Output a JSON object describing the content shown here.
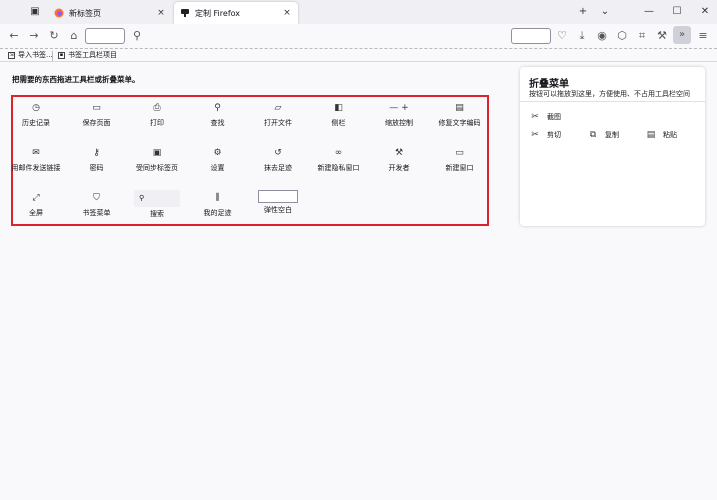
{
  "tabs": [
    {
      "title": "新标签页",
      "close": "×",
      "icon": "firefox-logo-icon"
    },
    {
      "title": "定制 Firefox",
      "close": "×",
      "icon": "customize-icon"
    }
  ],
  "window_controls": {
    "new_tab": "+",
    "tab_list": "⌄",
    "minimize": "—",
    "maximize": "☐",
    "close": "✕"
  },
  "bookmarks": [
    {
      "label": "导入书签..."
    },
    {
      "label": "书签工具栏项目"
    }
  ],
  "instruction": "把需要的东西拖进工具栏或折叠菜单。",
  "palette_items": [
    {
      "label": "历史记录",
      "icon": "history-icon",
      "glyph": "◷"
    },
    {
      "label": "保存页面",
      "icon": "save-page-icon",
      "glyph": "▭"
    },
    {
      "label": "打印",
      "icon": "print-icon",
      "glyph": "⎙"
    },
    {
      "label": "查找",
      "icon": "find-icon",
      "glyph": "⚲"
    },
    {
      "label": "打开文件",
      "icon": "open-file-icon",
      "glyph": "▱"
    },
    {
      "label": "侧栏",
      "icon": "sidebar-icon",
      "glyph": "◧"
    },
    {
      "label": "缩放控制",
      "icon": "zoom-controls-icon",
      "glyph": "— +"
    },
    {
      "label": "修复文字编码",
      "icon": "text-encoding-icon",
      "glyph": "▤"
    },
    {
      "label": "用邮件发送链接",
      "icon": "email-link-icon",
      "glyph": "✉"
    },
    {
      "label": "密码",
      "icon": "key-icon",
      "glyph": "⚷"
    },
    {
      "label": "受同步标签页",
      "icon": "synced-tabs-icon",
      "glyph": "▣"
    },
    {
      "label": "设置",
      "icon": "gear-icon",
      "glyph": "⚙"
    },
    {
      "label": "抹去足迹",
      "icon": "forget-icon",
      "glyph": "↺"
    },
    {
      "label": "新建隐私窗口",
      "icon": "private-window-icon",
      "glyph": "∞"
    },
    {
      "label": "开发者",
      "icon": "wrench-icon",
      "glyph": "⚒"
    },
    {
      "label": "新建窗口",
      "icon": "new-window-icon",
      "glyph": "▭"
    },
    {
      "label": "全屏",
      "icon": "fullscreen-icon",
      "glyph": "⤢"
    },
    {
      "label": "书签菜单",
      "icon": "bookmark-menu-icon",
      "glyph": "⛉"
    },
    {
      "label": "搜索",
      "icon": "search-icon",
      "glyph": "⚲"
    },
    {
      "label": "我的足迹",
      "icon": "library-icon",
      "glyph": "⫼"
    },
    {
      "label": "弹性空白",
      "icon": "flexible-space-icon",
      "glyph": ""
    }
  ],
  "overflow_menu": {
    "title": "折叠菜单",
    "description": "按钮可以拖放到这里，方便使用、不占用工具栏空间",
    "items": [
      {
        "label": "截图",
        "icon": "screenshot-icon",
        "glyph": "✂"
      },
      {
        "label": "剪切",
        "icon": "cut-icon",
        "glyph": "✂"
      },
      {
        "label": "复制",
        "icon": "copy-icon",
        "glyph": "⧉"
      },
      {
        "label": "粘贴",
        "icon": "paste-icon",
        "glyph": "▤"
      }
    ]
  }
}
